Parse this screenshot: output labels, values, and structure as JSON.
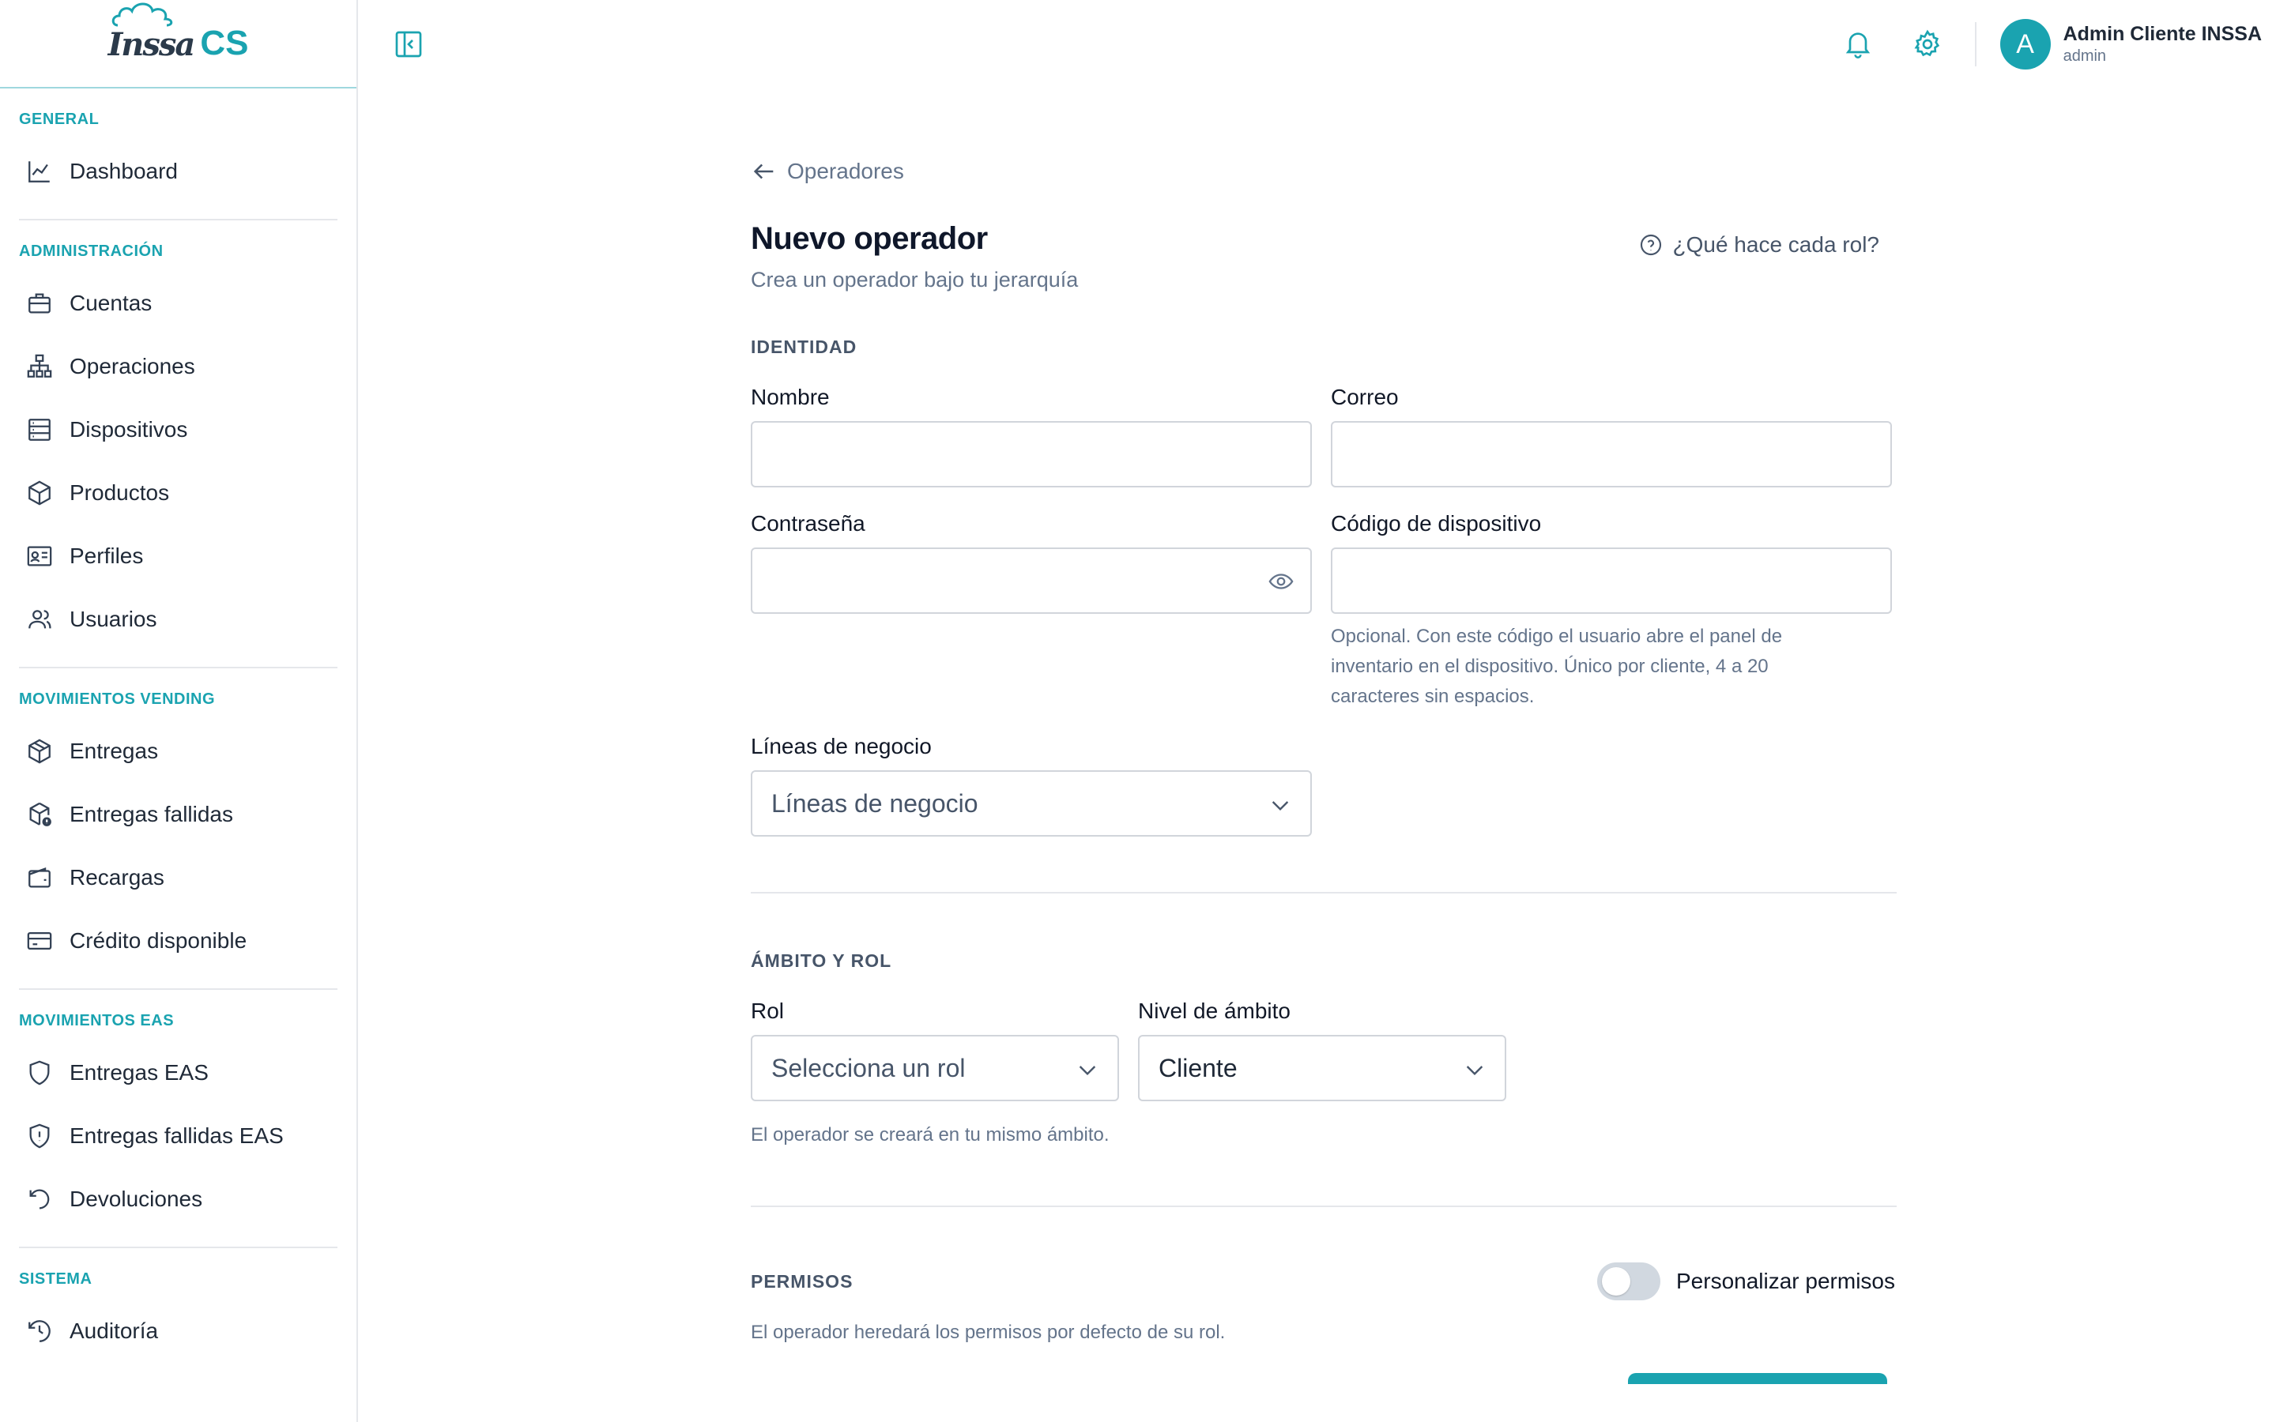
{
  "brand": {
    "logo_part1": "Inssa",
    "logo_part2": "CS",
    "accent": "#1aa3b0"
  },
  "sidebar": {
    "sections": [
      {
        "label": "GENERAL",
        "items": [
          {
            "label": "Dashboard",
            "icon": "chart-line-icon"
          }
        ]
      },
      {
        "label": "ADMINISTRACIÓN",
        "items": [
          {
            "label": "Cuentas",
            "icon": "briefcase-icon"
          },
          {
            "label": "Operaciones",
            "icon": "sitemap-icon"
          },
          {
            "label": "Dispositivos",
            "icon": "server-icon"
          },
          {
            "label": "Productos",
            "icon": "box-icon"
          },
          {
            "label": "Perfiles",
            "icon": "id-card-icon"
          },
          {
            "label": "Usuarios",
            "icon": "users-icon"
          }
        ]
      },
      {
        "label": "MOVIMIENTOS VENDING",
        "items": [
          {
            "label": "Entregas",
            "icon": "package-icon"
          },
          {
            "label": "Entregas fallidas",
            "icon": "package-alert-icon"
          },
          {
            "label": "Recargas",
            "icon": "wallet-icon"
          },
          {
            "label": "Crédito disponible",
            "icon": "credit-card-icon"
          }
        ]
      },
      {
        "label": "MOVIMIENTOS EAS",
        "items": [
          {
            "label": "Entregas EAS",
            "icon": "shield-icon"
          },
          {
            "label": "Entregas fallidas EAS",
            "icon": "shield-alert-icon"
          },
          {
            "label": "Devoluciones",
            "icon": "rotate-ccw-icon"
          }
        ]
      },
      {
        "label": "SISTEMA",
        "items": [
          {
            "label": "Auditoría",
            "icon": "history-icon"
          }
        ]
      }
    ]
  },
  "topbar": {
    "user_name": "Admin Cliente INSSA",
    "user_role": "admin",
    "avatar_letter": "A"
  },
  "page": {
    "back_label": "Operadores",
    "title": "Nuevo operador",
    "subtitle": "Crea un operador bajo tu jerarquía",
    "help_link": "¿Qué hace cada rol?"
  },
  "identity": {
    "heading": "IDENTIDAD",
    "name_label": "Nombre",
    "email_label": "Correo",
    "password_label": "Contraseña",
    "device_code_label": "Código de dispositivo",
    "device_code_hint": "Opcional. Con este código el usuario abre el panel de inventario en el dispositivo. Único por cliente, 4 a 20 caracteres sin espacios.",
    "business_lines_label": "Líneas de negocio",
    "business_lines_placeholder": "Líneas de negocio"
  },
  "scope": {
    "heading": "ÁMBITO Y ROL",
    "role_label": "Rol",
    "role_placeholder": "Selecciona un rol",
    "level_label": "Nivel de ámbito",
    "level_value": "Cliente",
    "hint": "El operador se creará en tu mismo ámbito."
  },
  "permissions": {
    "heading": "PERMISOS",
    "toggle_label": "Personalizar permisos",
    "toggle_on": false,
    "hint": "El operador heredará los permisos por defecto de su rol."
  }
}
